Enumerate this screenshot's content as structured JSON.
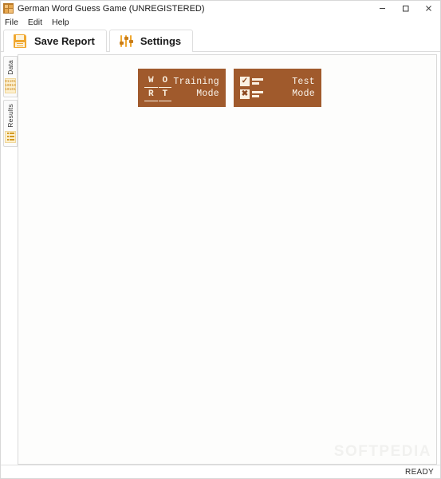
{
  "window": {
    "title": "German Word Guess Game (UNREGISTERED)",
    "app_icon": "grid-app-icon",
    "controls": {
      "minimize": "minimize-icon",
      "maximize": "maximize-icon",
      "close": "close-icon"
    }
  },
  "menubar": {
    "items": [
      {
        "label": "File"
      },
      {
        "label": "Edit"
      },
      {
        "label": "Help"
      }
    ]
  },
  "ribbon": {
    "tabs": [
      {
        "label": "Save Report",
        "icon": "save-floppy-icon"
      },
      {
        "label": "Settings",
        "icon": "sliders-icon"
      }
    ]
  },
  "side_tabs": [
    {
      "label": "Data",
      "icon": "binary-data-icon",
      "icon_rows": [
        "01101",
        "10010",
        "10101"
      ]
    },
    {
      "label": "Results",
      "icon": "list-results-icon"
    }
  ],
  "main": {
    "mode_buttons": [
      {
        "icon": "wort-letter-grid-icon",
        "icon_letters": [
          "W",
          "O",
          "R",
          "T"
        ],
        "line1": "Training",
        "line2": "Mode"
      },
      {
        "icon": "checklist-icon",
        "check_mark": "✓",
        "cross_mark": "✖",
        "line1": "Test",
        "line2": "Mode"
      }
    ],
    "watermark": "SOFTPEDIA"
  },
  "statusbar": {
    "text": "READY"
  },
  "colors": {
    "brand_brown": "#a05a2c",
    "accent_orange": "#f0a830",
    "icon_cream": "#fbf1e2",
    "binary_gold": "#c8820f"
  }
}
